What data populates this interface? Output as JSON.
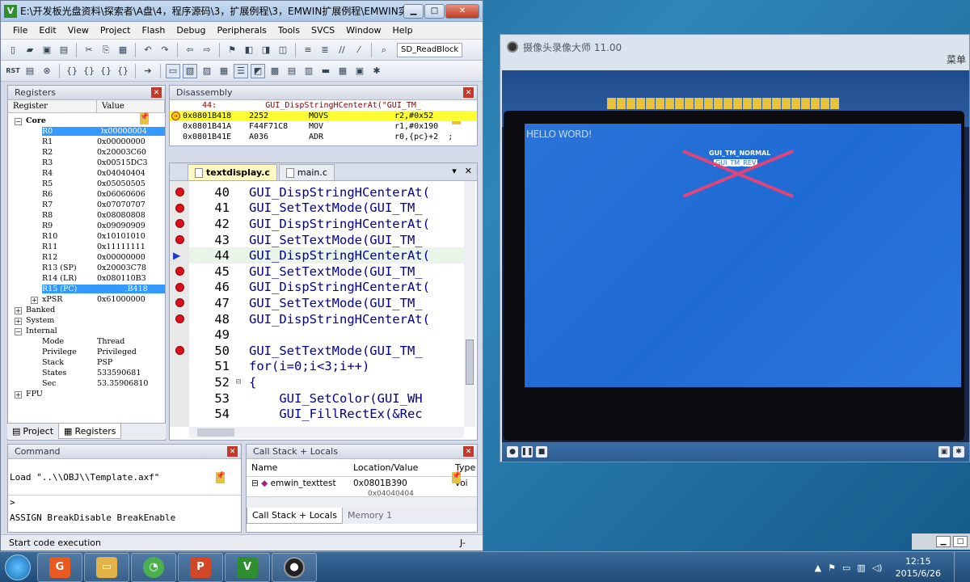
{
  "keil": {
    "title": "E:\\开发板光盘资料\\探索者\\A盘\\4，程序源码\\3，扩展例程\\3，EMWIN扩展例程\\EMWIN实...",
    "menu": [
      "File",
      "Edit",
      "View",
      "Project",
      "Flash",
      "Debug",
      "Peripherals",
      "Tools",
      "SVCS",
      "Window",
      "Help"
    ],
    "target_combo": "SD_ReadBlock",
    "registers": {
      "panel_title": "Registers",
      "col_register": "Register",
      "col_value": "Value",
      "group_core": "Core",
      "rows": [
        {
          "name": "R0",
          "value": "0x00000004",
          "selected": true
        },
        {
          "name": "R1",
          "value": "0x00000000"
        },
        {
          "name": "R2",
          "value": "0x20003C60"
        },
        {
          "name": "R3",
          "value": "0x00515DC3"
        },
        {
          "name": "R4",
          "value": "0x04040404"
        },
        {
          "name": "R5",
          "value": "0x05050505"
        },
        {
          "name": "R6",
          "value": "0x06060606"
        },
        {
          "name": "R7",
          "value": "0x07070707"
        },
        {
          "name": "R8",
          "value": "0x08080808"
        },
        {
          "name": "R9",
          "value": "0x09090909"
        },
        {
          "name": "R10",
          "value": "0x10101010"
        },
        {
          "name": "R11",
          "value": "0x11111111"
        },
        {
          "name": "R12",
          "value": "0x00000000"
        },
        {
          "name": "R13 (SP)",
          "value": "0x20003C78"
        },
        {
          "name": "R14 (LR)",
          "value": "0x080110B3"
        },
        {
          "name": "R15 (PC)",
          "value": "0x0801B418",
          "selected": true
        },
        {
          "name": "xPSR",
          "value": "0x61000000"
        }
      ],
      "groups": [
        "Banked",
        "System",
        "Internal"
      ],
      "internal": [
        {
          "name": "Mode",
          "value": "Thread"
        },
        {
          "name": "Privilege",
          "value": "Privileged"
        },
        {
          "name": "Stack",
          "value": "PSP"
        },
        {
          "name": "States",
          "value": "533590681"
        },
        {
          "name": "Sec",
          "value": "53.35906810"
        }
      ],
      "fpu": "FPU",
      "tab_project": "Project",
      "tab_registers": "Registers"
    },
    "disassembly": {
      "panel_title": "Disassembly",
      "header_line": "44:          GUI_DispStringHCenterAt(\"GUI_TM_",
      "lines": [
        {
          "addr": "0x0801B418",
          "hex": "2252",
          "op": "MOVS",
          "args": "r2,#0x52"
        },
        {
          "addr": "0x0801B41A",
          "hex": "F44F71C8",
          "op": "MOV",
          "args": "r1,#0x190"
        },
        {
          "addr": "0x0801B41E",
          "hex": "A036",
          "op": "ADR",
          "args": "r0,{pc}+2  ;"
        }
      ]
    },
    "editor": {
      "tabs": [
        "textdisplay.c",
        "main.c"
      ],
      "lines": [
        {
          "n": "40",
          "code": "GUI_DispStringHCenterAt(",
          "bp": true
        },
        {
          "n": "41",
          "code": "GUI_SetTextMode(GUI_TM_",
          "bp": true
        },
        {
          "n": "42",
          "code": "GUI_DispStringHCenterAt(",
          "bp": true
        },
        {
          "n": "43",
          "code": "GUI_SetTextMode(GUI_TM_",
          "bp": true
        },
        {
          "n": "44",
          "code": "GUI_DispStringHCenterAt(",
          "bp": false,
          "current": true
        },
        {
          "n": "45",
          "code": "GUI_SetTextMode(GUI_TM_",
          "bp": true
        },
        {
          "n": "46",
          "code": "GUI_DispStringHCenterAt(",
          "bp": true
        },
        {
          "n": "47",
          "code": "GUI_SetTextMode(GUI_TM_",
          "bp": true
        },
        {
          "n": "48",
          "code": "GUI_DispStringHCenterAt(",
          "bp": true
        },
        {
          "n": "49",
          "code": "",
          "bp": false
        },
        {
          "n": "50",
          "code": "GUI_SetTextMode(GUI_TM_",
          "bp": true
        },
        {
          "n": "51",
          "code": "for(i=0;i<3;i++)",
          "bp": false
        },
        {
          "n": "52",
          "code": "{",
          "bp": false
        },
        {
          "n": "53",
          "code": "    GUI_SetColor(GUI_WH",
          "bp": false
        },
        {
          "n": "54",
          "code": "    GUI_FillRectEx(&Rec",
          "bp": false
        }
      ]
    },
    "command": {
      "panel_title": "Command",
      "output": "Load \"..\\\\OBJ\\\\Template.axf\"",
      "prompt": ">",
      "hint": "ASSIGN BreakDisable BreakEnable"
    },
    "callstack": {
      "panel_title": "Call Stack + Locals",
      "col_name": "Name",
      "col_location": "Location/Value",
      "col_type": "Type",
      "row_name": "emwin_texttest",
      "row_location": "0x0801B390",
      "row_type": "voi",
      "row2_location": "0x04040404",
      "tab_callstack": "Call Stack + Locals",
      "tab_memory": "Memory 1"
    },
    "status": "Start code execution",
    "status_right": "J-"
  },
  "camera": {
    "title": "摄像头录像大师 11.00",
    "menu_fragment": "菜单",
    "lcd_hello": "HELLO WORD!",
    "lcd_normal": "GUI_TM_NORMAL",
    "lcd_rev": "GUI_TM_REV"
  },
  "taskbar": {
    "time": "12:15",
    "date": "2015/6/26"
  }
}
